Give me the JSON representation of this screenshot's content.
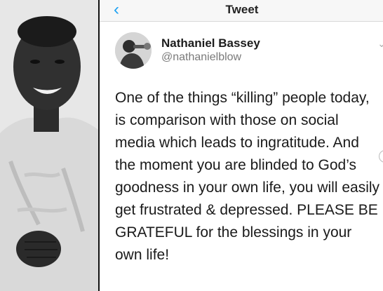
{
  "nav": {
    "back_symbol": "‹",
    "title": "Tweet"
  },
  "author": {
    "name": "Nathaniel Bassey",
    "handle": "@nathanielblow"
  },
  "tweet": {
    "text": "One of the things “killing” people today, is comparison with those on social media which leads to ingratitude. And the moment you are blinded to God’s goodness in your own life, you will easily get frustrated & depressed. PLEASE BE GRATEFUL for the blessings in your own life!"
  },
  "colors": {
    "accent": "#1da1f2"
  },
  "icons": {
    "back": "chevron-left-icon",
    "menu": "chevron-down-icon"
  }
}
